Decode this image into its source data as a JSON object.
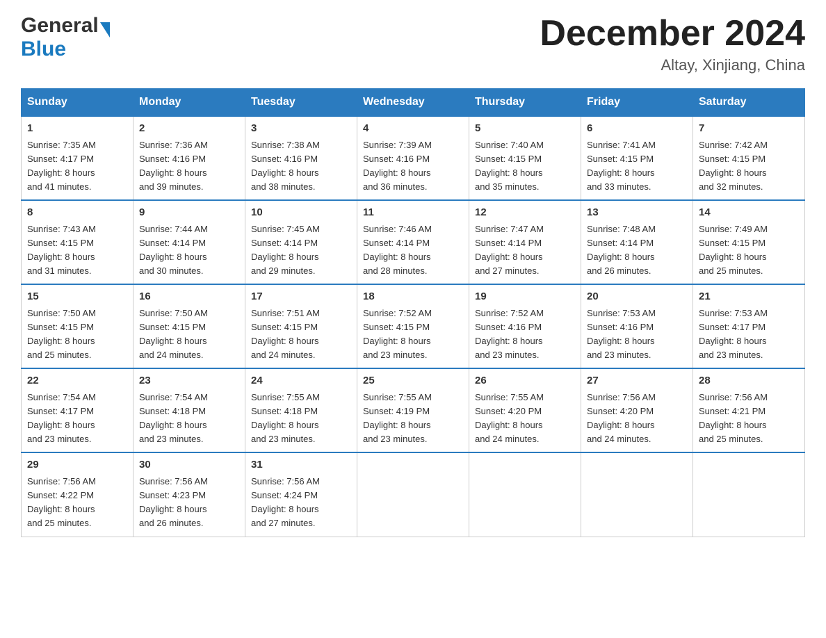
{
  "header": {
    "logo_general": "General",
    "logo_blue": "Blue",
    "month_title": "December 2024",
    "location": "Altay, Xinjiang, China"
  },
  "days_of_week": [
    "Sunday",
    "Monday",
    "Tuesday",
    "Wednesday",
    "Thursday",
    "Friday",
    "Saturday"
  ],
  "weeks": [
    [
      {
        "day": "1",
        "sunrise": "7:35 AM",
        "sunset": "4:17 PM",
        "daylight": "8 hours and 41 minutes."
      },
      {
        "day": "2",
        "sunrise": "7:36 AM",
        "sunset": "4:16 PM",
        "daylight": "8 hours and 39 minutes."
      },
      {
        "day": "3",
        "sunrise": "7:38 AM",
        "sunset": "4:16 PM",
        "daylight": "8 hours and 38 minutes."
      },
      {
        "day": "4",
        "sunrise": "7:39 AM",
        "sunset": "4:16 PM",
        "daylight": "8 hours and 36 minutes."
      },
      {
        "day": "5",
        "sunrise": "7:40 AM",
        "sunset": "4:15 PM",
        "daylight": "8 hours and 35 minutes."
      },
      {
        "day": "6",
        "sunrise": "7:41 AM",
        "sunset": "4:15 PM",
        "daylight": "8 hours and 33 minutes."
      },
      {
        "day": "7",
        "sunrise": "7:42 AM",
        "sunset": "4:15 PM",
        "daylight": "8 hours and 32 minutes."
      }
    ],
    [
      {
        "day": "8",
        "sunrise": "7:43 AM",
        "sunset": "4:15 PM",
        "daylight": "8 hours and 31 minutes."
      },
      {
        "day": "9",
        "sunrise": "7:44 AM",
        "sunset": "4:14 PM",
        "daylight": "8 hours and 30 minutes."
      },
      {
        "day": "10",
        "sunrise": "7:45 AM",
        "sunset": "4:14 PM",
        "daylight": "8 hours and 29 minutes."
      },
      {
        "day": "11",
        "sunrise": "7:46 AM",
        "sunset": "4:14 PM",
        "daylight": "8 hours and 28 minutes."
      },
      {
        "day": "12",
        "sunrise": "7:47 AM",
        "sunset": "4:14 PM",
        "daylight": "8 hours and 27 minutes."
      },
      {
        "day": "13",
        "sunrise": "7:48 AM",
        "sunset": "4:14 PM",
        "daylight": "8 hours and 26 minutes."
      },
      {
        "day": "14",
        "sunrise": "7:49 AM",
        "sunset": "4:15 PM",
        "daylight": "8 hours and 25 minutes."
      }
    ],
    [
      {
        "day": "15",
        "sunrise": "7:50 AM",
        "sunset": "4:15 PM",
        "daylight": "8 hours and 25 minutes."
      },
      {
        "day": "16",
        "sunrise": "7:50 AM",
        "sunset": "4:15 PM",
        "daylight": "8 hours and 24 minutes."
      },
      {
        "day": "17",
        "sunrise": "7:51 AM",
        "sunset": "4:15 PM",
        "daylight": "8 hours and 24 minutes."
      },
      {
        "day": "18",
        "sunrise": "7:52 AM",
        "sunset": "4:15 PM",
        "daylight": "8 hours and 23 minutes."
      },
      {
        "day": "19",
        "sunrise": "7:52 AM",
        "sunset": "4:16 PM",
        "daylight": "8 hours and 23 minutes."
      },
      {
        "day": "20",
        "sunrise": "7:53 AM",
        "sunset": "4:16 PM",
        "daylight": "8 hours and 23 minutes."
      },
      {
        "day": "21",
        "sunrise": "7:53 AM",
        "sunset": "4:17 PM",
        "daylight": "8 hours and 23 minutes."
      }
    ],
    [
      {
        "day": "22",
        "sunrise": "7:54 AM",
        "sunset": "4:17 PM",
        "daylight": "8 hours and 23 minutes."
      },
      {
        "day": "23",
        "sunrise": "7:54 AM",
        "sunset": "4:18 PM",
        "daylight": "8 hours and 23 minutes."
      },
      {
        "day": "24",
        "sunrise": "7:55 AM",
        "sunset": "4:18 PM",
        "daylight": "8 hours and 23 minutes."
      },
      {
        "day": "25",
        "sunrise": "7:55 AM",
        "sunset": "4:19 PM",
        "daylight": "8 hours and 23 minutes."
      },
      {
        "day": "26",
        "sunrise": "7:55 AM",
        "sunset": "4:20 PM",
        "daylight": "8 hours and 24 minutes."
      },
      {
        "day": "27",
        "sunrise": "7:56 AM",
        "sunset": "4:20 PM",
        "daylight": "8 hours and 24 minutes."
      },
      {
        "day": "28",
        "sunrise": "7:56 AM",
        "sunset": "4:21 PM",
        "daylight": "8 hours and 25 minutes."
      }
    ],
    [
      {
        "day": "29",
        "sunrise": "7:56 AM",
        "sunset": "4:22 PM",
        "daylight": "8 hours and 25 minutes."
      },
      {
        "day": "30",
        "sunrise": "7:56 AM",
        "sunset": "4:23 PM",
        "daylight": "8 hours and 26 minutes."
      },
      {
        "day": "31",
        "sunrise": "7:56 AM",
        "sunset": "4:24 PM",
        "daylight": "8 hours and 27 minutes."
      },
      null,
      null,
      null,
      null
    ]
  ],
  "labels": {
    "sunrise": "Sunrise:",
    "sunset": "Sunset:",
    "daylight": "Daylight:"
  }
}
